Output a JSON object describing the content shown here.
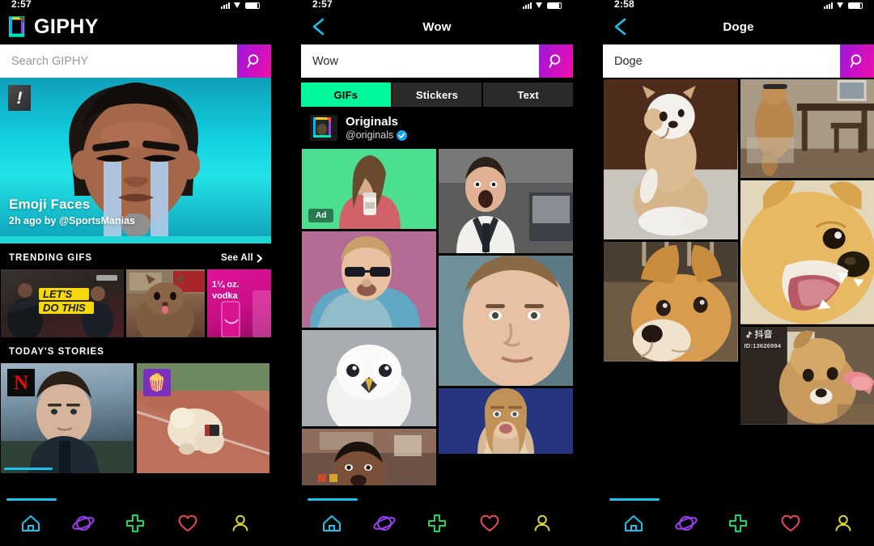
{
  "screens": {
    "left": {
      "status": {
        "time": "2:57",
        "battery_icon": "battery-icon",
        "wifi_icon": "wifi-icon",
        "signal_icon": "signal-bars-icon"
      },
      "brand": "GIPHY",
      "logo_icon": "giphy-logo-icon",
      "search": {
        "value": "",
        "placeholder": "Search GIPHY",
        "button_icon": "search-icon"
      },
      "featured": {
        "badge": "!",
        "title": "Emoji Faces",
        "subtitle": "2h ago by @SportsManias"
      },
      "sections": [
        {
          "title": "TRENDING GIFS",
          "action": "See All",
          "action_icon": "chevron-right-icon"
        },
        {
          "title": "TODAY'S STORIES"
        }
      ],
      "trending_tiles": [
        {
          "name": "lets-do-this",
          "caption": "LET'S",
          "caption2": "DO THIS"
        },
        {
          "name": "tiktok-cat",
          "caption": ""
        },
        {
          "name": "vodka-ad",
          "caption": "1¼ oz.",
          "caption2": "vodka"
        }
      ],
      "story_tiles": [
        {
          "name": "netflix-story",
          "badge": "N",
          "badge_kind": "netflix"
        },
        {
          "name": "popcorn-story",
          "badge": "🍿",
          "badge_kind": "popcorn"
        }
      ]
    },
    "mid": {
      "status": {
        "time": "2:57"
      },
      "back_icon": "back-chevron-icon",
      "title": "Wow",
      "search": {
        "value": "Wow",
        "placeholder": "Search GIPHY",
        "button_icon": "search-icon"
      },
      "tabs": [
        {
          "label": "GIFs",
          "active": true
        },
        {
          "label": "Stickers",
          "active": false
        },
        {
          "label": "Text",
          "active": false
        }
      ],
      "channel": {
        "name": "Originals",
        "handle": "@originals",
        "verified_icon": "verified-badge-icon",
        "avatar_icon": "giphy-originals-avatar"
      },
      "grid": [
        {
          "name": "gif-barista-ad",
          "badge": "Ad"
        },
        {
          "name": "gif-shocked-office-man"
        },
        {
          "name": "gif-sunglasses-guy"
        },
        {
          "name": "gif-closeup-face"
        },
        {
          "name": "gif-white-owl"
        },
        {
          "name": "gif-surprised-man"
        },
        {
          "name": "gif-woman-blue-bg"
        }
      ]
    },
    "right": {
      "status": {
        "time": "2:58"
      },
      "back_icon": "back-chevron-icon",
      "title": "Doge",
      "search": {
        "value": "Doge",
        "placeholder": "Search GIPHY",
        "button_icon": "search-icon"
      },
      "grid": [
        {
          "name": "gif-shiba-plush-sitting"
        },
        {
          "name": "gif-shiba-jumping-table"
        },
        {
          "name": "gif-shiba-head-tilt"
        },
        {
          "name": "gif-shiba-barking"
        },
        {
          "name": "gif-shiba-blanket"
        },
        {
          "name": "gif-shiba-treat",
          "watermark": "抖音",
          "watermark_id": "ID:13626994",
          "watermark_icon": "tiktok-note-icon"
        }
      ]
    }
  },
  "bottom_nav": [
    {
      "name": "home",
      "icon": "home-icon",
      "color": "#19c3f0"
    },
    {
      "name": "explore",
      "icon": "planet-icon",
      "color": "#9b3cf0"
    },
    {
      "name": "create",
      "icon": "plus-icon",
      "color": "#13d862"
    },
    {
      "name": "favorites",
      "icon": "heart-icon",
      "color": "#f0485c"
    },
    {
      "name": "profile",
      "icon": "person-icon",
      "color": "#d8d82a"
    }
  ],
  "colors": {
    "accent_pink": "#f010a8",
    "accent_purple": "#9a1bd8",
    "accent_green": "#00f79a",
    "accent_cyan": "#19c3f0",
    "background": "#000000"
  }
}
